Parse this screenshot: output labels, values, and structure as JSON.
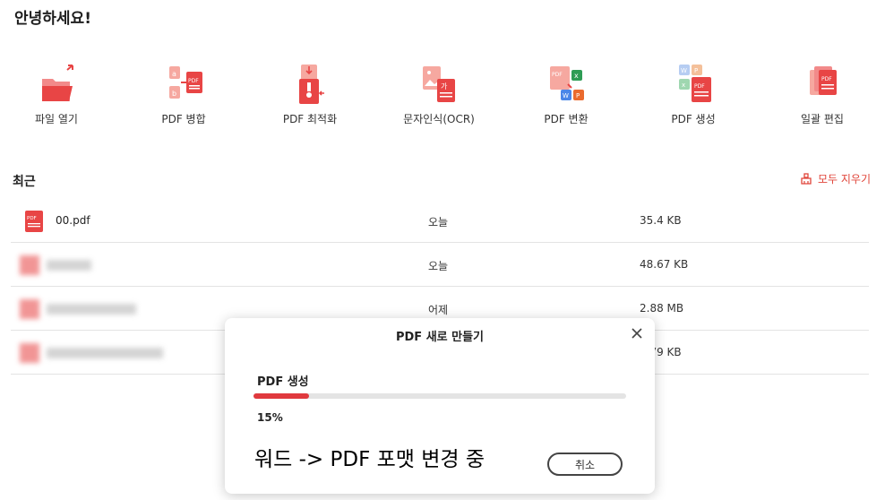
{
  "greeting": "안녕하세요!",
  "tools": [
    {
      "label": "파일 열기",
      "icon": "folder-open-icon"
    },
    {
      "label": "PDF 병합",
      "icon": "pdf-merge-icon"
    },
    {
      "label": "PDF 최적화",
      "icon": "pdf-compress-icon"
    },
    {
      "label": "문자인식(OCR)",
      "icon": "ocr-icon"
    },
    {
      "label": "PDF 변환",
      "icon": "pdf-convert-icon"
    },
    {
      "label": "PDF 생성",
      "icon": "pdf-create-icon"
    },
    {
      "label": "일괄 편집",
      "icon": "batch-edit-icon"
    }
  ],
  "recent": {
    "title": "최근",
    "clear_label": "모두 지우기",
    "files": [
      {
        "name": "00.pdf",
        "date": "오늘",
        "size": "35.4 KB"
      },
      {
        "name": "",
        "date": "오늘",
        "size": "48.67 KB"
      },
      {
        "name": "",
        "date": "어제",
        "size": "2.88 MB"
      },
      {
        "name": "",
        "date": "",
        "size": "0.79 KB"
      }
    ]
  },
  "dialog": {
    "title": "PDF 새로 만들기",
    "subtitle": "PDF 생성",
    "progress": 0.15,
    "percent_text": "15%",
    "status": "워드 -> PDF 포맷 변경 중",
    "cancel_label": "취소"
  },
  "colors": {
    "accent": "#e0393e",
    "danger": "#e0453a"
  }
}
